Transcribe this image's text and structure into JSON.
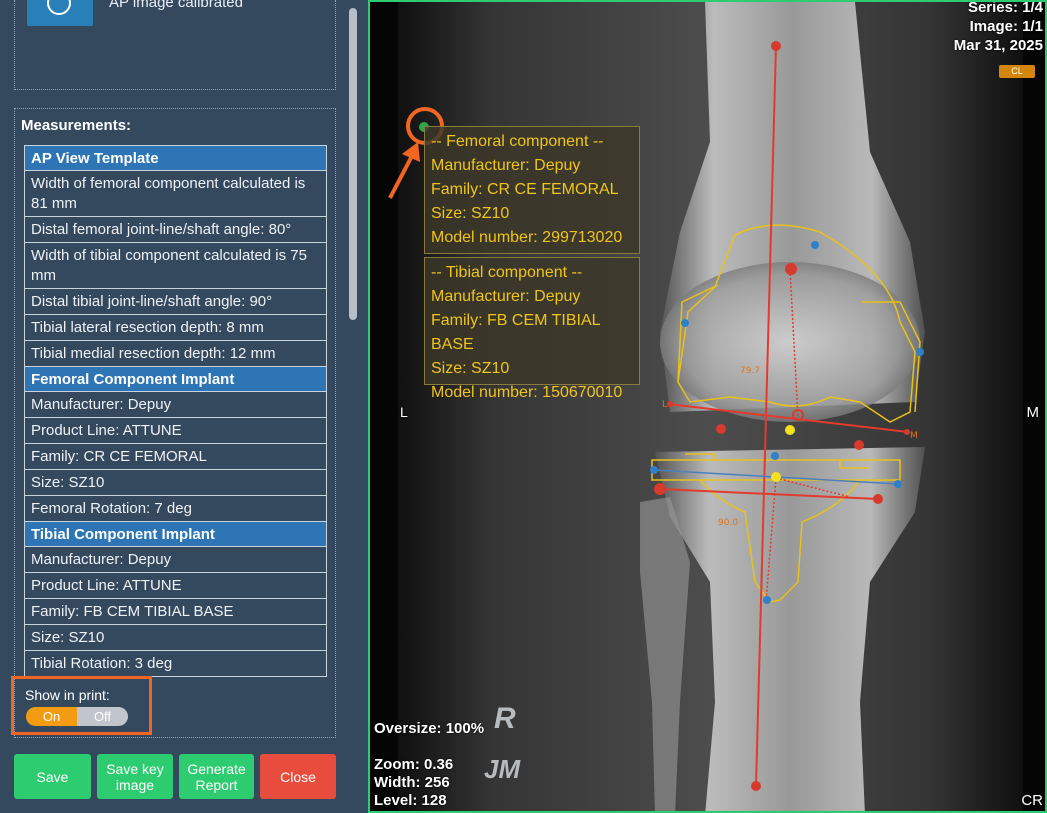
{
  "calibration": {
    "text": "AP image calibrated"
  },
  "measurements": {
    "title": "Measurements:",
    "rows": [
      {
        "type": "header",
        "text": "AP View Template"
      },
      {
        "type": "row",
        "text": "Width of femoral component calculated is 81 mm"
      },
      {
        "type": "row",
        "text": "Distal femoral joint-line/shaft angle: 80°"
      },
      {
        "type": "row",
        "text": "Width of tibial component calculated is 75 mm"
      },
      {
        "type": "row",
        "text": "Distal tibial joint-line/shaft angle: 90°"
      },
      {
        "type": "row",
        "text": "Tibial lateral resection depth: 8 mm"
      },
      {
        "type": "row",
        "text": "Tibial medial resection depth: 12 mm"
      },
      {
        "type": "header",
        "text": "Femoral Component Implant"
      },
      {
        "type": "row",
        "text": "Manufacturer: Depuy"
      },
      {
        "type": "row",
        "text": "Product Line: ATTUNE"
      },
      {
        "type": "row",
        "text": "Family: CR CE FEMORAL"
      },
      {
        "type": "row",
        "text": "Size: SZ10"
      },
      {
        "type": "row",
        "text": "Femoral Rotation: 7 deg"
      },
      {
        "type": "header",
        "text": "Tibial Component Implant"
      },
      {
        "type": "row",
        "text": "Manufacturer: Depuy"
      },
      {
        "type": "row",
        "text": "Product Line: ATTUNE"
      },
      {
        "type": "row",
        "text": "Family: FB CEM TIBIAL BASE"
      },
      {
        "type": "row",
        "text": "Size: SZ10"
      },
      {
        "type": "row",
        "text": "Tibial Rotation: 3 deg"
      }
    ]
  },
  "print_toggle": {
    "label": "Show in print:",
    "on": "On",
    "off": "Off",
    "selected": "On"
  },
  "buttons": {
    "save": "Save",
    "save_key_1": "Save key",
    "save_key_2": "image",
    "report_1": "Generate",
    "report_2": "Report",
    "close": "Close"
  },
  "viewer": {
    "series": "Series: 1/4",
    "image": "Image: 1/1",
    "date": "Mar 31, 2025",
    "badge": "CL",
    "marker_left": "L",
    "marker_right": "M",
    "oversize": "Oversize: 100%",
    "zoom": "Zoom: 0.36",
    "width": "Width: 256",
    "level": "Level: 128",
    "corner": "CR",
    "watermark_r": "R",
    "watermark_jm": "JM",
    "angle_fem": "79.7",
    "angle_tib": "90.0",
    "lbl_L": "L",
    "lbl_M": "M"
  },
  "femoral_info": {
    "title": "-- Femoral component --",
    "manufacturer": "Manufacturer: Depuy",
    "family": "Family: CR CE FEMORAL",
    "size": "Size: SZ10",
    "model": "Model number: 299713020"
  },
  "tibial_info": {
    "title": "-- Tibial component --",
    "manufacturer": "Manufacturer: Depuy",
    "family": "Family: FB CEM TIBIAL BASE",
    "size": "Size: SZ10",
    "model": "Model number: 150670010"
  },
  "colors": {
    "panel": "#34495e",
    "header": "#2e75b6",
    "green": "#2ecc71",
    "red": "#e74c3c",
    "toggle_on": "#f39c12",
    "highlight": "#f26522",
    "overlay_yellow": "#f0c419"
  }
}
